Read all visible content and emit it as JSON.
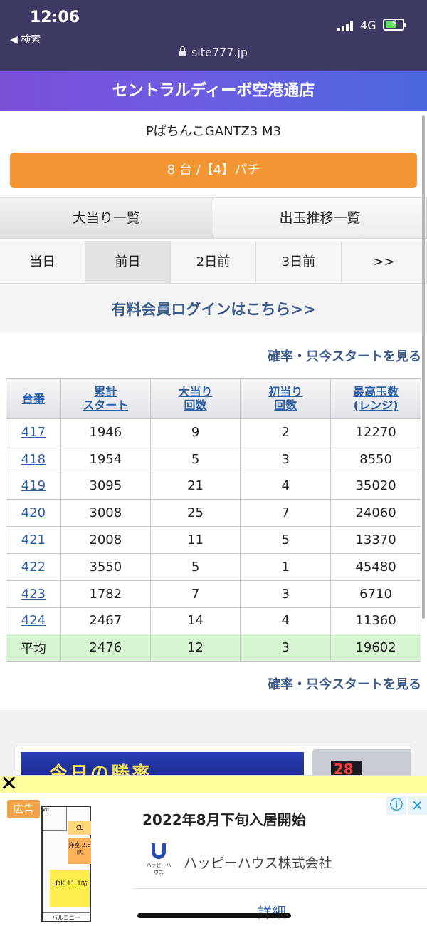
{
  "status": {
    "time": "12:06",
    "back": "◀ 検索",
    "network": "4G",
    "url": "site777.jp"
  },
  "store": {
    "name": "セントラルディーボ空港通店"
  },
  "machine": {
    "name": "PぱちんこGANTZ3 M3",
    "count_button": "8 台 /【4】パチ"
  },
  "tabs": [
    {
      "label": "大当り一覧"
    },
    {
      "label": "出玉推移一覧"
    }
  ],
  "days": [
    {
      "label": "当日"
    },
    {
      "label": "前日"
    },
    {
      "label": "2日前"
    },
    {
      "label": "3日前"
    },
    {
      "label": ">>"
    }
  ],
  "login_link": "有料会員ログインはこちら>>",
  "prob_link": "確率・只今スタートを見る",
  "table": {
    "headers": [
      {
        "l1": "台番",
        "l2": ""
      },
      {
        "l1": "累計",
        "l2": "スタート"
      },
      {
        "l1": "大当り",
        "l2": "回数"
      },
      {
        "l1": "初当り",
        "l2": "回数"
      },
      {
        "l1": "最高玉数",
        "l2": "(レンジ)"
      }
    ],
    "rows": [
      [
        "417",
        "1946",
        "9",
        "2",
        "12270"
      ],
      [
        "418",
        "1954",
        "5",
        "3",
        "8550"
      ],
      [
        "419",
        "3095",
        "21",
        "4",
        "35020"
      ],
      [
        "420",
        "3008",
        "25",
        "7",
        "24060"
      ],
      [
        "421",
        "2008",
        "11",
        "5",
        "13370"
      ],
      [
        "422",
        "3550",
        "5",
        "1",
        "45480"
      ],
      [
        "423",
        "1782",
        "7",
        "3",
        "6710"
      ],
      [
        "424",
        "2467",
        "14",
        "4",
        "11360"
      ]
    ],
    "average": [
      "平均",
      "2476",
      "12",
      "3",
      "19602"
    ]
  },
  "banner": {
    "text": "今日の勝率",
    "number": "28"
  },
  "ad": {
    "close_x": "✕",
    "label": "広告",
    "info": "ⓘ",
    "close": "✕",
    "plan": {
      "wc": "WC",
      "cl": "CL",
      "room": "洋室 2.8帖",
      "ldk": "LDK 11.1帖",
      "balcony": "バルコニー"
    },
    "headline": "2022年8月下旬入居開始",
    "logo_text": "ハッピーハウス",
    "company": "ハッピーハウス株式会社",
    "detail": "詳細"
  }
}
